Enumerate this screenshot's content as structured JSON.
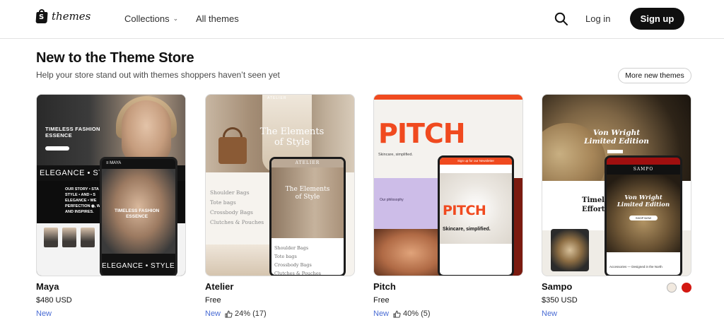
{
  "header": {
    "logo_text": "themes",
    "nav": [
      {
        "label": "Collections",
        "has_dropdown": true
      },
      {
        "label": "All themes",
        "has_dropdown": false
      }
    ],
    "login_label": "Log in",
    "signup_label": "Sign up"
  },
  "section": {
    "title": "New to the Theme Store",
    "subtitle": "Help your store stand out with themes shoppers haven’t seen yet",
    "more_label": "More new themes"
  },
  "themes": [
    {
      "name": "Maya",
      "price": "$480 USD",
      "badge": "New",
      "preview": {
        "hero_text": "TIMELESS FASHION\nESSENCE",
        "band_text": "ELEGANCE • STYLE • FO",
        "story_text": "OUR STORY • STA\nSTYLE • AND • S\nELEGANCE • WE\nPERFECTION ◉, WE\nAND INSPIRES.",
        "phone_brand": "≡ MAYA",
        "phone_text": "TIMELESS FASHION\nESSENCE",
        "phone_band": "ELEGANCE • STYLE"
      }
    },
    {
      "name": "Atelier",
      "price": "Free",
      "badge": "New",
      "rating": "24% (17)",
      "preview": {
        "brand": "ATELIER",
        "hero_text": "The Elements\nof Style",
        "list": [
          "Shoulder Bags",
          "Tote bags",
          "Crossbody Bags",
          "Clutches & Pouches"
        ],
        "phone_brand": "ATELIER",
        "phone_title": "The Elements\nof Style",
        "phone_list": [
          "Shoulder Bags",
          "Tote bags",
          "Crossbody Bags",
          "Clutches & Pouches"
        ]
      }
    },
    {
      "name": "Pitch",
      "price": "Free",
      "badge": "New",
      "rating": "40% (5)",
      "preview": {
        "big_text": "PITCH",
        "skincare": "Skincare, simplified.",
        "philosophy": "Our philosophy",
        "phone_top": "Sign up for our Newsletter",
        "phone_big": "PITCH",
        "phone_tag": "Skincare, simplified."
      }
    },
    {
      "name": "Sampo",
      "price": "$350 USD",
      "badge": "New",
      "swatches": [
        "#f1e9df",
        "#d31912"
      ],
      "preview": {
        "brand": "SAMPO",
        "hero_text": "Von Wright\nLimited Edition",
        "mid_text": "Timel\nEffortle",
        "phone_brand": "SAMPO",
        "phone_title": "Von Wright\nLimited Edition",
        "phone_button": "SHOP NOW",
        "phone_bottom": "Accessories — Designed in the North"
      }
    }
  ],
  "colors": {
    "signup_bg": "#0f0f0f",
    "new_badge": "#4a6cd4",
    "pitch_orange": "#f04a1f",
    "sampo_red": "#d31912"
  },
  "icons": [
    "shopify-bag-icon",
    "chevron-down-icon",
    "search-icon",
    "thumbs-up-icon"
  ]
}
